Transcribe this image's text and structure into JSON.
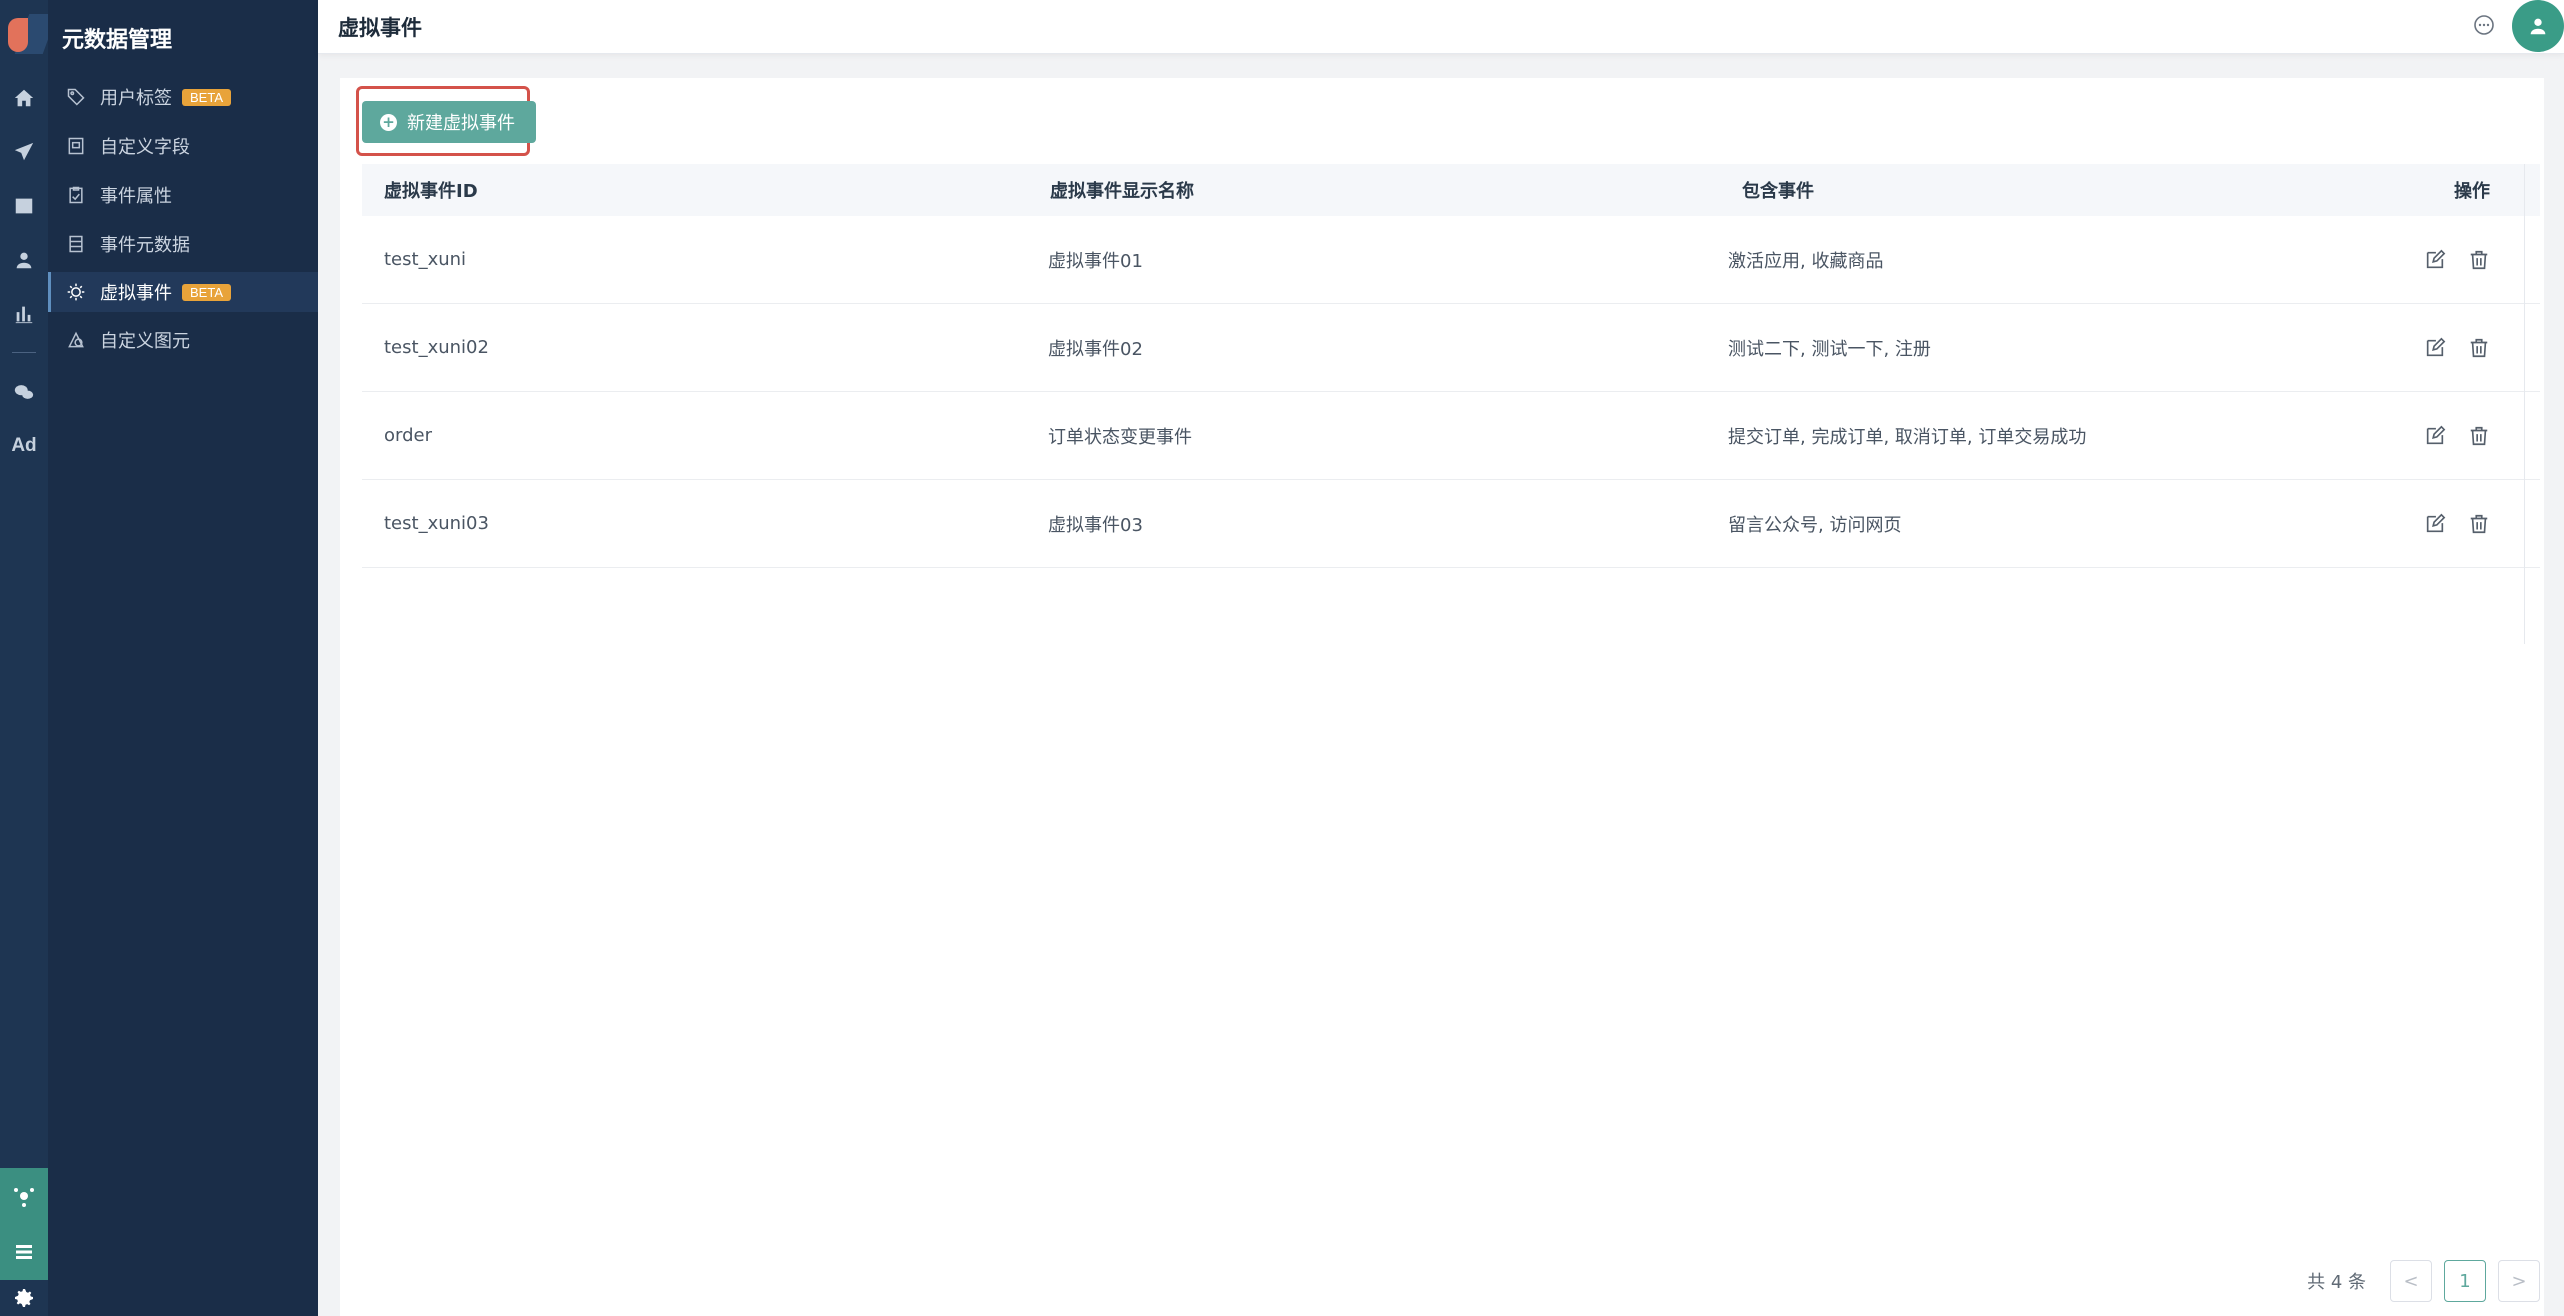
{
  "sidebar": {
    "title": "元数据管理",
    "items": [
      {
        "label": "用户标签",
        "badge": "BETA",
        "icon": "tag-icon"
      },
      {
        "label": "自定义字段",
        "icon": "custom-field-icon"
      },
      {
        "label": "事件属性",
        "icon": "clipboard-icon"
      },
      {
        "label": "事件元数据",
        "icon": "list-icon"
      },
      {
        "label": "虚拟事件",
        "badge": "BETA",
        "icon": "virtual-event-icon",
        "active": true
      },
      {
        "label": "自定义图元",
        "icon": "custom-element-icon"
      }
    ]
  },
  "rail": {
    "ad_label": "Ad"
  },
  "header": {
    "title": "虚拟事件"
  },
  "toolbar": {
    "new_label": "新建虚拟事件"
  },
  "table": {
    "columns": [
      "虚拟事件ID",
      "虚拟事件显示名称",
      "包含事件",
      "操作"
    ],
    "rows": [
      {
        "id": "test_xuni",
        "name": "虚拟事件01",
        "events": "激活应用, 收藏商品"
      },
      {
        "id": "test_xuni02",
        "name": "虚拟事件02",
        "events": "测试二下, 测试一下, 注册"
      },
      {
        "id": "order",
        "name": "订单状态变更事件",
        "events": "提交订单, 完成订单, 取消订单, 订单交易成功"
      },
      {
        "id": "test_xuni03",
        "name": "虚拟事件03",
        "events": "留言公众号, 访问网页"
      }
    ]
  },
  "pagination": {
    "total": "共 4 条",
    "prev": "<",
    "current": "1",
    "next": ">"
  },
  "colors": {
    "primary": "#5ea89d",
    "sidebar_bg": "#1a2d48",
    "rail_bg": "#1e3552",
    "highlight": "#d4524a",
    "beta": "#e8a33a"
  }
}
